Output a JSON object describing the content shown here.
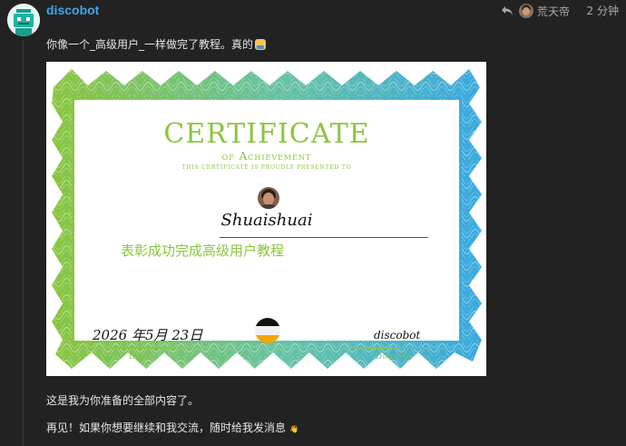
{
  "post": {
    "username": "discobot",
    "reply_to_name": "荒天帝",
    "time": "2 分钟",
    "intro_text": "你像一个_高级用户_一样做完了教程。真的",
    "outro_text": "这是我为你准备的全部内容了。",
    "farewell_text": "再见！如果你想要继续和我交流，随时给我发消息",
    "icons": [
      "reply-arrow-icon",
      "laptop-emoji-icon",
      "bot-avatar",
      "wave-emoji-icon"
    ]
  },
  "certificate": {
    "title": "CERTIFICATE",
    "subtitle": "of Achievement",
    "presented": "this certificate is proudly presented to",
    "recipient": "Shuaishuai",
    "description": "表彰成功完成高级用户教程",
    "date": "2026 年5月 23日",
    "date_label": "Date",
    "director_signature": "discobot",
    "director_label": "Director",
    "colors": {
      "green": "#8bc53f",
      "blue": "#3aa9e0",
      "background": "#222222",
      "link": "#3fa8e8"
    }
  }
}
